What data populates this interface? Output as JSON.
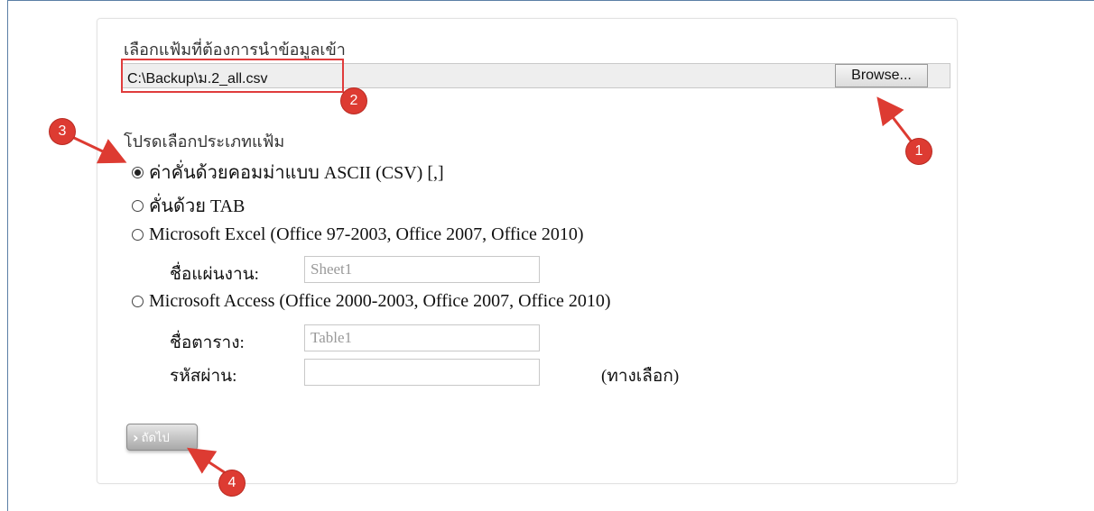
{
  "file_selection": {
    "label": "เลือกแฟ้มที่ต้องการนำข้อมูลเข้า",
    "path_value": "C:\\Backup\\ม.2_all.csv",
    "browse_label": "Browse..."
  },
  "file_type": {
    "label": "โปรดเลือกประเภทแฟ้ม",
    "options": [
      {
        "label": "ค่าคั่นด้วยคอมม่าแบบ ASCII (CSV) [,]",
        "checked": true
      },
      {
        "label": "คั่นด้วย TAB",
        "checked": false
      },
      {
        "label": "Microsoft Excel (Office 97-2003, Office 2007, Office 2010)",
        "checked": false
      },
      {
        "label": "Microsoft Access (Office 2000-2003, Office 2007, Office 2010)",
        "checked": false
      }
    ],
    "sheet_name_label": "ชื่อแผ่นงาน:",
    "sheet_name_value": "Sheet1",
    "table_name_label": "ชื่อตาราง:",
    "table_name_value": "Table1",
    "password_label": "รหัสผ่าน:",
    "password_value": "",
    "optional_note": "(ทางเลือก)"
  },
  "next_button": {
    "label": "ถัดไป"
  },
  "annotations": {
    "badges": [
      "1",
      "2",
      "3",
      "4"
    ],
    "color": "#dd3b32"
  }
}
